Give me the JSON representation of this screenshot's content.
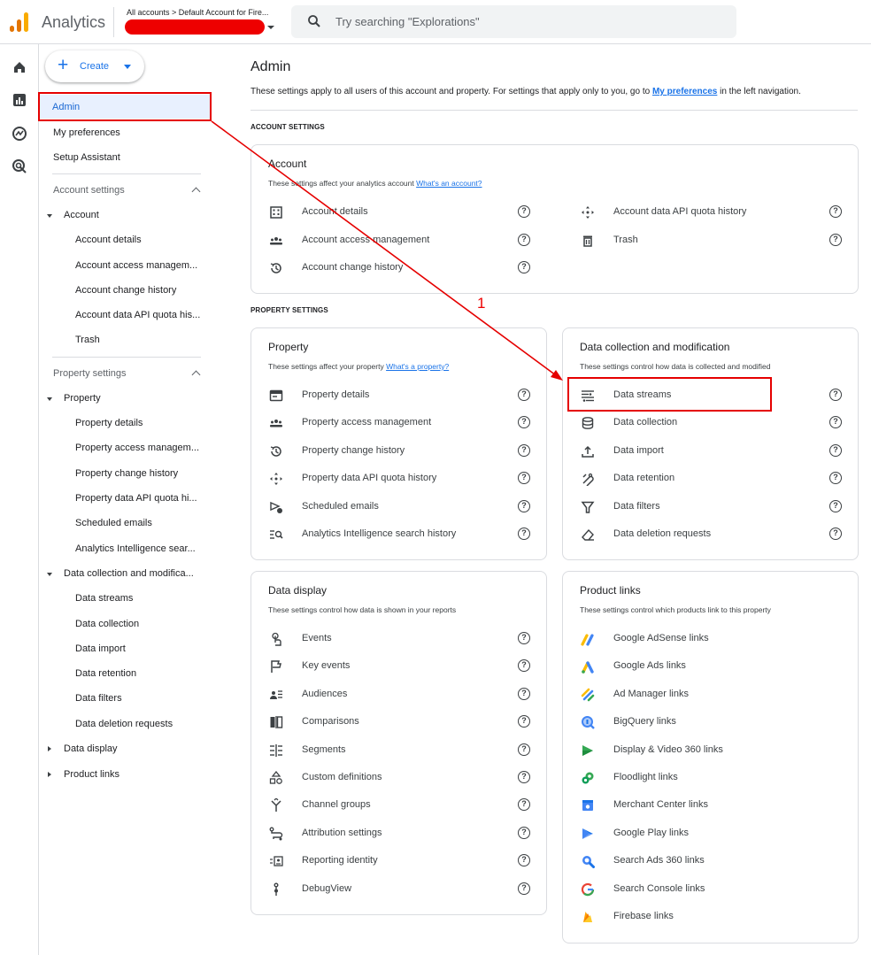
{
  "app": {
    "name": "Analytics",
    "breadcrumb": "All accounts > Default Account for Fire...",
    "search_placeholder": "Try searching \"Explorations\""
  },
  "sidebar": {
    "create_label": "Create",
    "top_items": [
      "Admin",
      "My preferences",
      "Setup Assistant"
    ],
    "account_settings_label": "Account settings",
    "account_group": "Account",
    "account_items": [
      "Account details",
      "Account access managem...",
      "Account change history",
      "Account data API quota his...",
      "Trash"
    ],
    "property_settings_label": "Property settings",
    "property_group": "Property",
    "property_items": [
      "Property details",
      "Property access managem...",
      "Property change history",
      "Property data API quota hi...",
      "Scheduled emails",
      "Analytics Intelligence sear..."
    ],
    "dcm_group": "Data collection and modifica...",
    "dcm_items": [
      "Data streams",
      "Data collection",
      "Data import",
      "Data retention",
      "Data filters",
      "Data deletion requests"
    ],
    "data_display_group": "Data display",
    "product_links_group": "Product links"
  },
  "main": {
    "title": "Admin",
    "desc_before": "These settings apply to all users of this account and property. For settings that apply only to you, go to ",
    "desc_link": "My preferences",
    "desc_after": " in the left navigation.",
    "account_section": "ACCOUNT SETTINGS",
    "property_section": "PROPERTY SETTINGS",
    "account_card": {
      "title": "Account",
      "desc": "These settings affect your analytics account",
      "link": "What's an account?",
      "left": [
        {
          "label": "Account details",
          "icon": "building-icon"
        },
        {
          "label": "Account access management",
          "icon": "people-icon"
        },
        {
          "label": "Account change history",
          "icon": "history-icon"
        }
      ],
      "right": [
        {
          "label": "Account data API quota history",
          "icon": "move-icon"
        },
        {
          "label": "Trash",
          "icon": "trash-icon"
        }
      ]
    },
    "property_card": {
      "title": "Property",
      "desc": "These settings affect your property",
      "link": "What's a property?",
      "items": [
        {
          "label": "Property details",
          "icon": "property-details-icon"
        },
        {
          "label": "Property access management",
          "icon": "people-icon"
        },
        {
          "label": "Property change history",
          "icon": "history-icon"
        },
        {
          "label": "Property data API quota history",
          "icon": "move-icon"
        },
        {
          "label": "Scheduled emails",
          "icon": "scheduled-email-icon"
        },
        {
          "label": "Analytics Intelligence search history",
          "icon": "search-list-icon"
        }
      ]
    },
    "dcm_card": {
      "title": "Data collection and modification",
      "desc": "These settings control how data is collected and modified",
      "items": [
        {
          "label": "Data streams",
          "icon": "data-streams-icon"
        },
        {
          "label": "Data collection",
          "icon": "database-icon"
        },
        {
          "label": "Data import",
          "icon": "upload-icon"
        },
        {
          "label": "Data retention",
          "icon": "retention-icon"
        },
        {
          "label": "Data filters",
          "icon": "filter-icon"
        },
        {
          "label": "Data deletion requests",
          "icon": "eraser-icon"
        }
      ]
    },
    "display_card": {
      "title": "Data display",
      "desc": "These settings control how data is shown in your reports",
      "items": [
        {
          "label": "Events",
          "icon": "touch-icon"
        },
        {
          "label": "Key events",
          "icon": "flag-icon"
        },
        {
          "label": "Audiences",
          "icon": "audience-icon"
        },
        {
          "label": "Comparisons",
          "icon": "compare-icon"
        },
        {
          "label": "Segments",
          "icon": "segments-icon"
        },
        {
          "label": "Custom definitions",
          "icon": "shapes-icon"
        },
        {
          "label": "Channel groups",
          "icon": "merge-icon"
        },
        {
          "label": "Attribution settings",
          "icon": "route-icon"
        },
        {
          "label": "Reporting identity",
          "icon": "id-card-icon"
        },
        {
          "label": "DebugView",
          "icon": "debug-icon"
        }
      ]
    },
    "links_card": {
      "title": "Product links",
      "desc": "These settings control which products link to this property",
      "items": [
        {
          "label": "Google AdSense links",
          "icon": "adsense-icon"
        },
        {
          "label": "Google Ads links",
          "icon": "google-ads-icon"
        },
        {
          "label": "Ad Manager links",
          "icon": "ad-manager-icon"
        },
        {
          "label": "BigQuery links",
          "icon": "bigquery-icon"
        },
        {
          "label": "Display & Video 360 links",
          "icon": "dv360-icon"
        },
        {
          "label": "Floodlight links",
          "icon": "floodlight-icon"
        },
        {
          "label": "Merchant Center links",
          "icon": "merchant-center-icon"
        },
        {
          "label": "Google Play links",
          "icon": "google-play-icon"
        },
        {
          "label": "Search Ads 360 links",
          "icon": "search-ads-icon"
        },
        {
          "label": "Search Console links",
          "icon": "google-g-icon"
        },
        {
          "label": "Firebase links",
          "icon": "firebase-icon"
        }
      ]
    }
  },
  "annotation": {
    "step_label": "1",
    "color": "#e50000"
  }
}
